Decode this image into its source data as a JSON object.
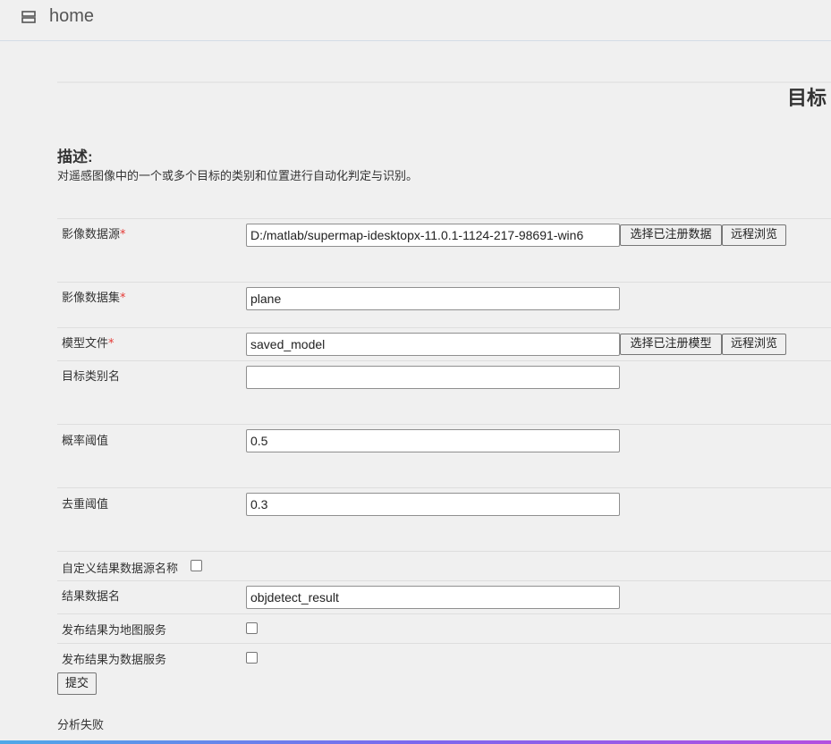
{
  "header": {
    "title": "home",
    "menu_icon": "menu-icon"
  },
  "page": {
    "heading": "目标"
  },
  "description": {
    "title": "描述:",
    "text": "对遥感图像中的一个或多个目标的类别和位置进行自动化判定与识别。"
  },
  "form": {
    "image_datasource": {
      "label": "影像数据源",
      "required_mark": "*",
      "value": "D:/matlab/supermap-idesktopx-11.0.1-1124-217-98691-win6",
      "select_registered_button": "选择已注册数据",
      "remote_browse_button": "远程浏览"
    },
    "image_dataset": {
      "label": "影像数据集",
      "required_mark": "*",
      "value": "plane"
    },
    "model_file": {
      "label": "模型文件",
      "required_mark": "*",
      "value": "saved_model",
      "select_registered_button": "选择已注册模型",
      "remote_browse_button": "远程浏览"
    },
    "target_class_name": {
      "label": "目标类别名",
      "value": ""
    },
    "probability_threshold": {
      "label": "概率阈值",
      "value": "0.5"
    },
    "nms_threshold": {
      "label": "去重阈值",
      "value": "0.3"
    },
    "custom_result_datasource": {
      "label": "自定义结果数据源名称",
      "checked": false
    },
    "result_data_name": {
      "label": "结果数据名",
      "value": "objdetect_result"
    },
    "publish_map_service": {
      "label": "发布结果为地图服务",
      "checked": false
    },
    "publish_data_service": {
      "label": "发布结果为数据服务",
      "checked": false
    },
    "submit_button": "提交"
  },
  "status": {
    "text": "分析失败"
  }
}
